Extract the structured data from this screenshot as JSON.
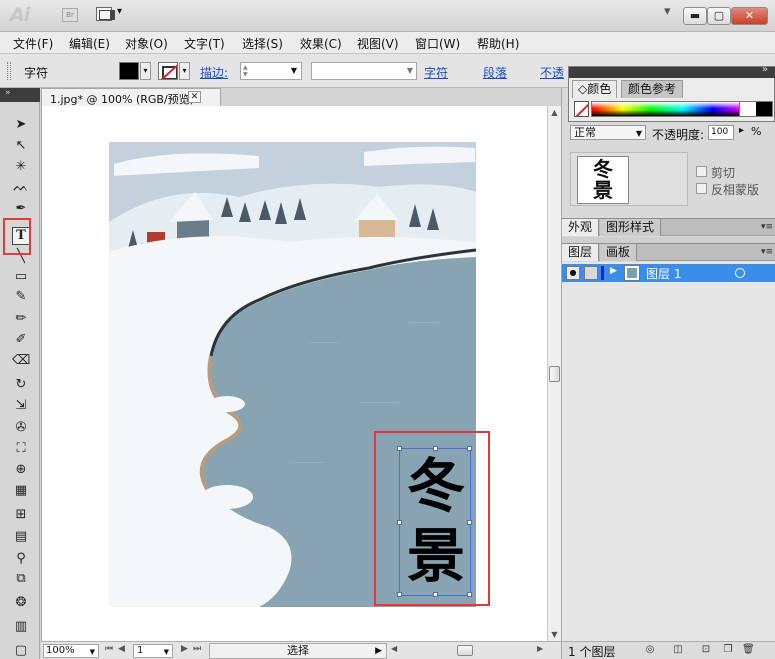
{
  "app": {
    "logo": "Ai",
    "bridge_label": "Br"
  },
  "menu": [
    "文件(F)",
    "编辑(E)",
    "对象(O)",
    "文字(T)",
    "选择(S)",
    "效果(C)",
    "视图(V)",
    "窗口(W)",
    "帮助(H)"
  ],
  "control": {
    "tool_label": "字符",
    "stroke_label": "描边:",
    "character_link": "字符",
    "paragraph_link": "段落",
    "opacity_link": "不透"
  },
  "document": {
    "tab_title": "1.jpg* @ 100% (RGB/预览)"
  },
  "artwork": {
    "text_char_1": "冬",
    "text_char_2": "景"
  },
  "status": {
    "zoom": "100%",
    "page": "1",
    "tool": "选择"
  },
  "panels": {
    "color_tab": "颜色",
    "color_guide_tab": "颜色参考",
    "blend_mode": "正常",
    "opacity_label": "不透明度:",
    "opacity_value": "100",
    "opacity_unit": "%",
    "thumb_char_1": "冬",
    "thumb_char_2": "景",
    "clip_label": "剪切",
    "invert_mask_label": "反相蒙版",
    "appearance_tab": "外观",
    "graphic_styles_tab": "图形样式",
    "layers_tab": "图层",
    "artboards_tab": "画板",
    "layer_name": "图层 1",
    "layer_count": "1 个图层"
  },
  "colors": {
    "selection_blue": "#3a8de8",
    "bounding_box": "#4a6bd9",
    "highlight_red": "#e03a3a",
    "lake": "#88a4b3",
    "snow": "#f4f7f9"
  }
}
